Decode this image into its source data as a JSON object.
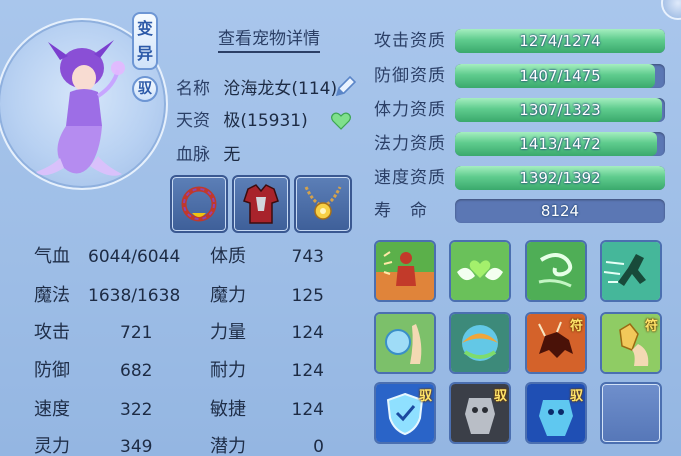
{
  "pet": {
    "badge_variant": "变\n异",
    "badge_yu": "驭",
    "view_detail_label": "查看宠物详情",
    "name_key": "名称",
    "name_value": "沧海龙女(114)",
    "talent_key": "天资",
    "talent_value": "极(15931)",
    "blood_key": "血脉",
    "blood_value": "无"
  },
  "stats_left": [
    {
      "label": "气血",
      "value": "6044/6044"
    },
    {
      "label": "魔法",
      "value": "1638/1638"
    },
    {
      "label": "攻击",
      "value": "721"
    },
    {
      "label": "防御",
      "value": "682"
    },
    {
      "label": "速度",
      "value": "322"
    },
    {
      "label": "灵力",
      "value": "349"
    }
  ],
  "stats_right": [
    {
      "label": "体质",
      "value": "743"
    },
    {
      "label": "魔力",
      "value": "125"
    },
    {
      "label": "力量",
      "value": "124"
    },
    {
      "label": "耐力",
      "value": "124"
    },
    {
      "label": "敏捷",
      "value": "124"
    },
    {
      "label": "潜力",
      "value": "0"
    }
  ],
  "aptitudes": [
    {
      "label": "攻击资质",
      "text": "1274/1274",
      "current": 1274,
      "max": 1274
    },
    {
      "label": "防御资质",
      "text": "1407/1475",
      "current": 1407,
      "max": 1475
    },
    {
      "label": "体力资质",
      "text": "1307/1323",
      "current": 1307,
      "max": 1323
    },
    {
      "label": "法力资质",
      "text": "1413/1472",
      "current": 1413,
      "max": 1472
    },
    {
      "label": "速度资质",
      "text": "1392/1392",
      "current": 1392,
      "max": 1392
    }
  ],
  "life": {
    "label": "寿　命",
    "value": "8124"
  },
  "skill_tags": {
    "fu": "符",
    "yu": "驭"
  },
  "colors": {
    "bar_fill": "#5fcc8e",
    "bar_track": "#5b77b4",
    "accent_blue": "#2d5aa8"
  }
}
